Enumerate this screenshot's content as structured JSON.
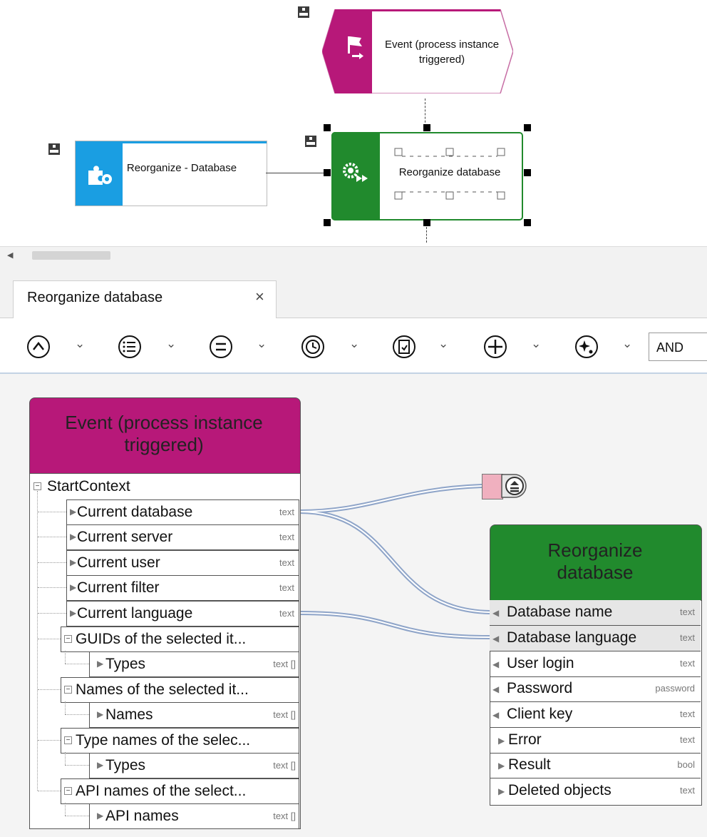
{
  "diagram": {
    "event_node": {
      "label": "Event (process instance triggered)",
      "color": "#b71879"
    },
    "function_node": {
      "label": "Reorganize - Database",
      "color": "#1a9ee2"
    },
    "selected_node": {
      "label": "Reorganize database",
      "color": "#218a2d"
    }
  },
  "tab": {
    "title": "Reorganize database",
    "close": "×"
  },
  "toolbar": {
    "buttons": [
      "up-circle-icon",
      "list-circle-icon",
      "equals-circle-icon",
      "clock-circle-icon",
      "document-circle-icon",
      "plus-circle-icon",
      "sparkle-circle-icon"
    ],
    "operator": "AND"
  },
  "event_card": {
    "title": "Event (process instance triggered)",
    "root": "StartContext",
    "rows": [
      {
        "label": "Current database",
        "type": "text"
      },
      {
        "label": "Current server",
        "type": "text"
      },
      {
        "label": "Current user",
        "type": "text"
      },
      {
        "label": "Current filter",
        "type": "text"
      },
      {
        "label": "Current language",
        "type": "text"
      }
    ],
    "groups": [
      {
        "label": "GUIDs of the selected it...",
        "child": "Types",
        "type": "text []"
      },
      {
        "label": "Names of the selected it...",
        "child": "Names",
        "type": "text []"
      },
      {
        "label": "Type names of the selec...",
        "child": "Types",
        "type": "text []"
      },
      {
        "label": "API names of the select...",
        "child": "API names",
        "type": "text []"
      }
    ]
  },
  "function_card": {
    "title": "Reorganize database",
    "rows": [
      {
        "label": "Database name",
        "type": "text",
        "dir": "in",
        "highlight": true
      },
      {
        "label": "Database language",
        "type": "text",
        "dir": "in",
        "highlight": true
      },
      {
        "label": "User login",
        "type": "text",
        "dir": "in",
        "highlight": false
      },
      {
        "label": "Password",
        "type": "password",
        "dir": "in",
        "highlight": false
      },
      {
        "label": "Client key",
        "type": "text",
        "dir": "in",
        "highlight": false
      },
      {
        "label": "Error",
        "type": "text",
        "dir": "out",
        "highlight": false
      },
      {
        "label": "Result",
        "type": "bool",
        "dir": "out",
        "highlight": false
      },
      {
        "label": "Deleted objects",
        "type": "text",
        "dir": "out",
        "highlight": false
      }
    ]
  }
}
